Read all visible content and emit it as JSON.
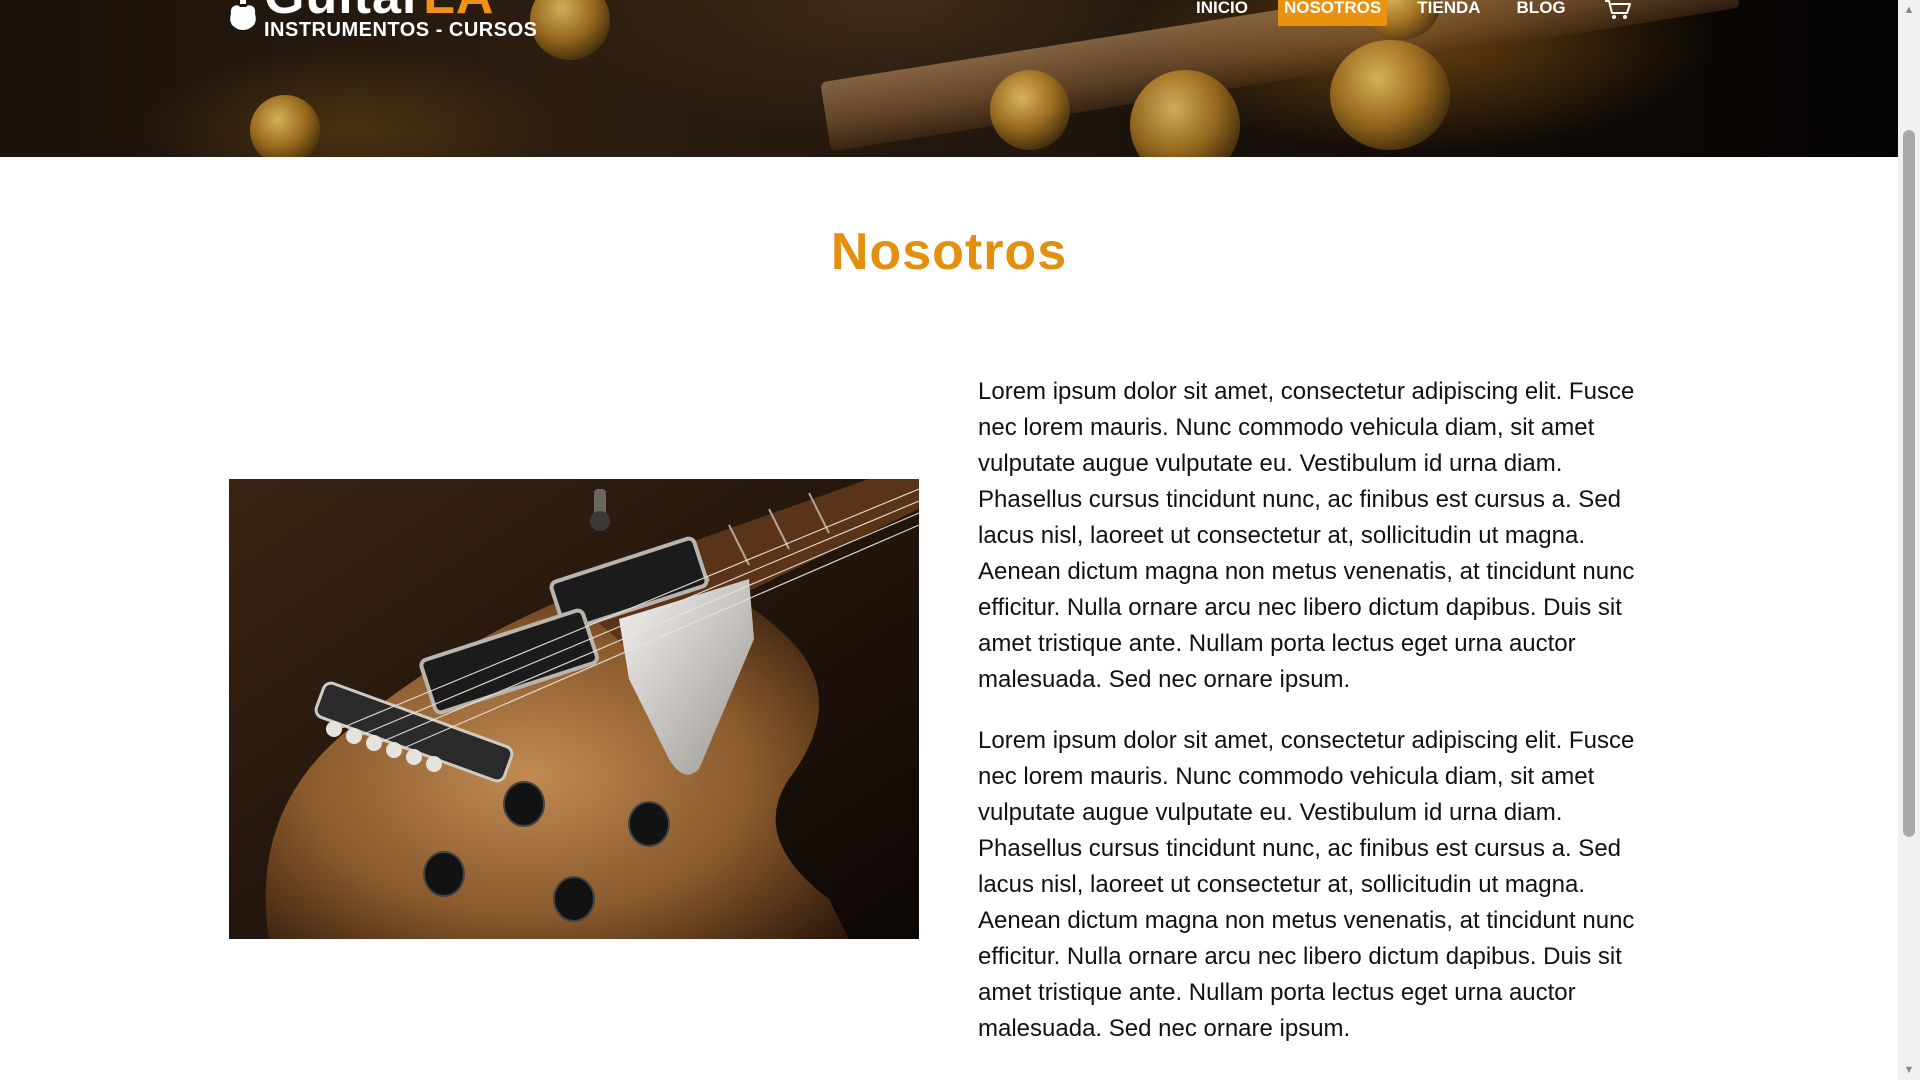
{
  "header": {
    "logo": {
      "name_white": "Guitar",
      "name_accent": "LA",
      "tagline": "INSTRUMENTOS - CURSOS"
    },
    "nav": [
      {
        "label": "INICIO",
        "active": false
      },
      {
        "label": "NOSOTROS",
        "active": true
      },
      {
        "label": "TIENDA",
        "active": false
      },
      {
        "label": "BLOG",
        "active": false
      }
    ],
    "cart_icon": "shopping-cart-icon"
  },
  "main": {
    "title": "Nosotros",
    "image_icon": "electric-guitar-photo",
    "paragraphs": [
      "Lorem ipsum dolor sit amet, consectetur adipiscing elit. Fusce nec lorem mauris. Nunc commodo vehicula diam, sit amet vulputate augue vulputate eu. Vestibulum id urna diam. Phasellus cursus tincidunt nunc, ac finibus est cursus a. Sed lacus nisl, laoreet ut consectetur at, sollicitudin ut magna. Aenean dictum magna non metus venenatis, at tincidunt nunc efficitur. Nulla ornare arcu nec libero dictum dapibus. Duis sit amet tristique ante. Nullam porta lectus eget urna auctor malesuada. Sed nec ornare ipsum.",
      "Lorem ipsum dolor sit amet, consectetur adipiscing elit. Fusce nec lorem mauris. Nunc commodo vehicula diam, sit amet vulputate augue vulputate eu. Vestibulum id urna diam. Phasellus cursus tincidunt nunc, ac finibus est cursus a. Sed lacus nisl, laoreet ut consectetur at, sollicitudin ut magna. Aenean dictum magna non metus venenatis, at tincidunt nunc efficitur. Nulla ornare arcu nec libero dictum dapibus. Duis sit amet tristique ante. Nullam porta lectus eget urna auctor malesuada. Sed nec ornare ipsum."
    ]
  },
  "colors": {
    "accent": "#e3900e",
    "nav_active_bg": "#e99210",
    "text": "#111111",
    "header_bg": "#1a120b"
  }
}
